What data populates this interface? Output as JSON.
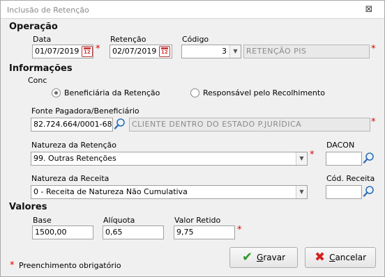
{
  "window": {
    "title": "Inclusão de Retenção",
    "close_glyph": "⊠"
  },
  "sections": {
    "operacao": "Operação",
    "informacoes": "Informações",
    "valores": "Valores"
  },
  "operacao": {
    "data_label": "Data",
    "data_value": "01/07/2019",
    "retencao_label": "Retenção",
    "retencao_value": "02/07/2019",
    "codigo_label": "Código",
    "codigo_value": "3",
    "codigo_desc": "RETENÇÃO PIS"
  },
  "informacoes": {
    "cond_label": "Conc",
    "radio_beneficiaria": "Beneficiária da Retenção",
    "radio_responsavel": "Responsável pelo Recolhimento",
    "selected_radio": "beneficiaria",
    "fonte_label": "Fonte Pagadora/Beneficiário",
    "fonte_value": "82.724.664/0001-68",
    "fonte_desc": "CLIENTE DENTRO DO ESTADO P.JURÍDICA",
    "natureza_retencao_label": "Natureza da Retenção",
    "natureza_retencao_value": "99. Outras Retenções",
    "dacon_label": "DACON",
    "dacon_value": "",
    "natureza_receita_label": "Natureza da Receita",
    "natureza_receita_value": "0 - Receita de Natureza Não Cumulativa",
    "cod_receita_label": "Cód. Receita",
    "cod_receita_value": ""
  },
  "valores": {
    "base_label": "Base",
    "base_value": "1500,00",
    "aliquota_label": "Alíquota",
    "aliquota_value": "0,65",
    "valor_retido_label": "Valor Retido",
    "valor_retido_value": "9,75"
  },
  "footer": {
    "required_note": "Preenchimento obrigatório",
    "required_mark": "*",
    "gravar_first": "G",
    "gravar_rest": "ravar",
    "cancelar_first": "C",
    "cancelar_rest": "ancelar"
  },
  "colors": {
    "required": "#e00000",
    "gravar_icon": "#2e9a2e",
    "cancelar_icon": "#d42020"
  },
  "icons": {
    "calendar": "calendar-icon",
    "search": "magnifier-icon",
    "dropdown": "chevron-down-icon"
  }
}
